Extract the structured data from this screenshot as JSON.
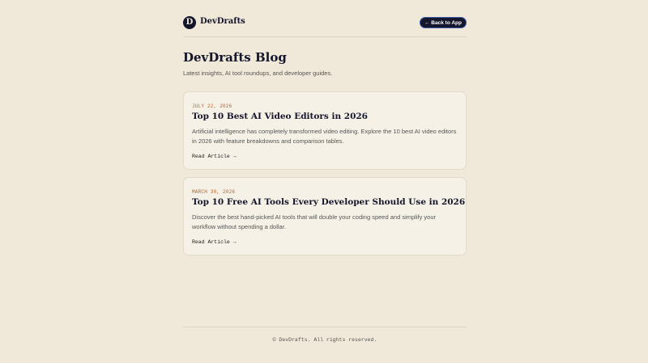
{
  "header": {
    "logo_letter": "D",
    "brand": "DevDrafts",
    "back_button": "← Back to App"
  },
  "hero": {
    "title": "DevDrafts Blog",
    "subtitle": "Latest insights, AI tool roundups, and developer guides."
  },
  "posts": [
    {
      "date": "JULY 22, 2026",
      "title": "Top 10 Best AI Video Editors in 2026",
      "description": "Artificial intelligence has completely transformed video editing. Explore the 10 best AI video editors in 2026 with feature breakdowns and comparison tables.",
      "link": "Read Article →"
    },
    {
      "date": "MARCH 30, 2026",
      "title": "Top 10 Free AI Tools Every Developer Should Use in 2026",
      "description": "Discover the best hand-picked AI tools that will double your coding speed and simplify your workflow without spending a dollar.",
      "link": "Read Article →"
    }
  ],
  "footer": {
    "copyright": "© DevDrafts. All rights reserved."
  },
  "colors": {
    "background": "#f0e8d9",
    "card": "#f6f1e7",
    "navy": "#14162b",
    "accent_date": "#b5652a"
  }
}
